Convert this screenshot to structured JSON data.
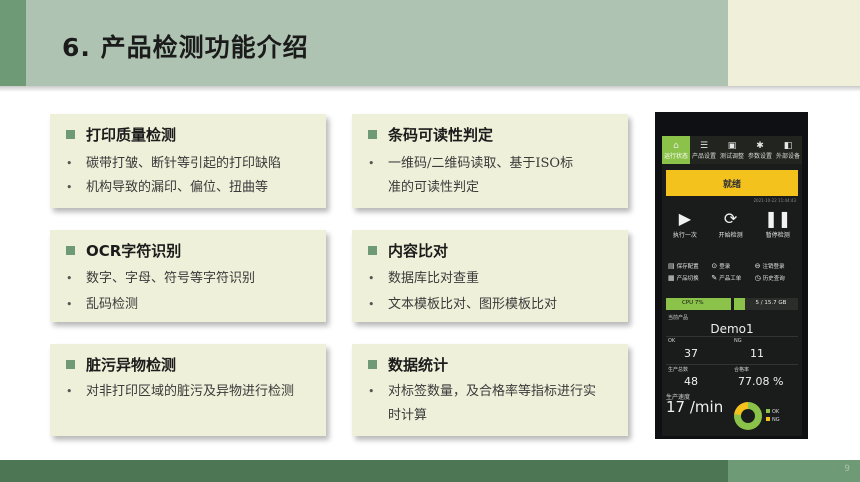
{
  "slide": {
    "title": "6. 产品检测功能介绍",
    "page_number": "9"
  },
  "cards": [
    {
      "title": "打印质量检测",
      "items": [
        "碳带打皱、断针等引起的打印缺陷",
        "机构导致的漏印、偏位、扭曲等"
      ]
    },
    {
      "title": "条码可读性判定",
      "items": [
        "一维码/二维码读取、基于ISO标",
        "准的可读性判定"
      ]
    },
    {
      "title": "OCR字符识别",
      "items": [
        "数字、字母、符号等字符识别",
        "乱码检测"
      ]
    },
    {
      "title": "内容比对",
      "items": [
        "数据库比对查重",
        "文本模板比对、图形模板比对"
      ]
    },
    {
      "title": "脏污异物检测",
      "items": [
        "对非打印区域的脏污及异物进行检测"
      ]
    },
    {
      "title": "数据统计",
      "items": [
        "对标签数量，及合格率等指标进行实",
        "时计算"
      ]
    }
  ],
  "device": {
    "tabs": [
      "运行状态",
      "产品设置",
      "测试调整",
      "参数设置",
      "外部设备"
    ],
    "status": "就绪",
    "date": "2021-10-22 11:44:43",
    "buttons": [
      "执行一次",
      "开始检测",
      "暂停检测"
    ],
    "grid": [
      "保存配置",
      "登录",
      "注销登录",
      "产品切换",
      "产品工单",
      "历史查询"
    ],
    "cpu": "CPU 7%",
    "mem": "5 / 15.7 GB",
    "product_label": "当前产品",
    "product": "Demo1",
    "ok_label": "OK",
    "ok_value": "37",
    "ng_label": "NG",
    "ng_value": "11",
    "total_label": "生产总数",
    "total_value": "48",
    "rate_label": "合格率",
    "rate_value": "77.08 %",
    "speed_label": "生产速度",
    "speed_value": "17 /min",
    "legend_ok": "OK",
    "legend_ng": "NG",
    "pass_rate_fraction": 0.7708,
    "cpu_fraction": 0.07,
    "colors": {
      "accent": "#8bc24a",
      "warning": "#f4c21d"
    }
  },
  "colors": {
    "header": "#aec3b2",
    "brand": "#6f9a76",
    "card": "#eef0d9",
    "footer": "#4d7655"
  }
}
